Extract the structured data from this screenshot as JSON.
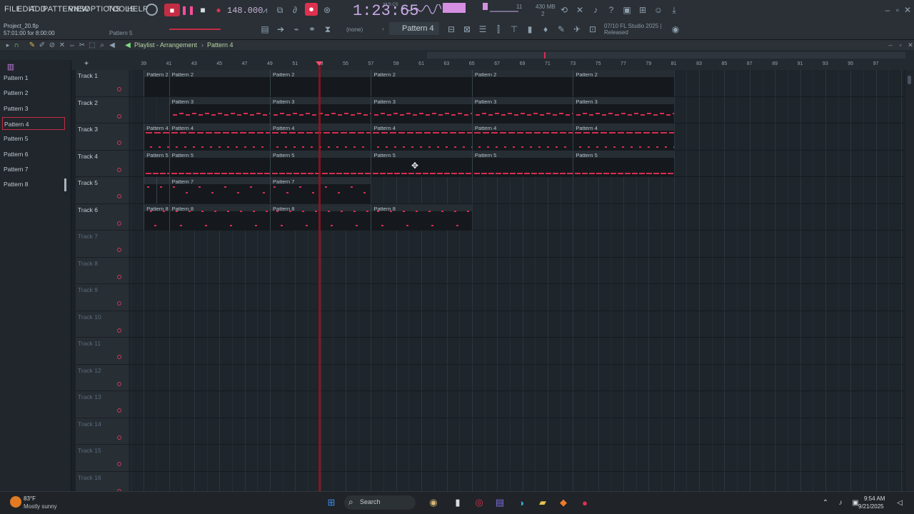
{
  "menu": [
    "FILE",
    "EDIT",
    "ADD",
    "PATTERNS",
    "VIEW",
    "OPTIONS",
    "TOOLS",
    "HELP"
  ],
  "project": {
    "name": "Project_20.flp",
    "time_info": "57:01:00 for 8:00:00",
    "hint": "Pattern 5"
  },
  "transport": {
    "tempo": "148.000",
    "time": "1:23:65",
    "time_label": "M:S:CS",
    "memory": "430 MB",
    "cpu_val": "11",
    "voices": "2"
  },
  "pattern_selector": {
    "current": "Pattern 4",
    "none_label": "(none)"
  },
  "news": {
    "line1": "07/10  FL Studio 2025 |",
    "line2": "Released"
  },
  "playlist": {
    "title": "Playlist - Arrangement",
    "separator": "›",
    "pattern": "Pattern 4"
  },
  "pattern_picker": [
    "Pattern 1",
    "Pattern 2",
    "Pattern 3",
    "Pattern 4",
    "Pattern 5",
    "Pattern 6",
    "Pattern 7",
    "Pattern 8"
  ],
  "ruler": [
    "39",
    "41",
    "43",
    "45",
    "47",
    "49",
    "51",
    "53",
    "55",
    "57",
    "59",
    "61",
    "63",
    "65",
    "67",
    "69",
    "71",
    "73",
    "75",
    "77",
    "79",
    "81",
    "83",
    "85",
    "87",
    "89",
    "91",
    "93",
    "95",
    "97"
  ],
  "tracks": [
    "Track 1",
    "Track 2",
    "Track 3",
    "Track 4",
    "Track 5",
    "Track 6",
    "Track 7",
    "Track 8",
    "Track 9",
    "Track 10",
    "Track 11",
    "Track 12",
    "Track 13",
    "Track 14",
    "Track 15",
    "Track 16"
  ],
  "clips": [
    {
      "track": 0,
      "label": "Pattern 2",
      "start": "39",
      "end": "41"
    },
    {
      "track": 0,
      "label": "Pattern 2",
      "start": "41",
      "end": "49"
    },
    {
      "track": 0,
      "label": "Pattern 2",
      "start": "49",
      "end": "57"
    },
    {
      "track": 0,
      "label": "Pattern 2",
      "start": "57",
      "end": "65"
    },
    {
      "track": 0,
      "label": "Pattern 2",
      "start": "65",
      "end": "73"
    },
    {
      "track": 0,
      "label": "Pattern 2",
      "start": "73",
      "end": "81"
    },
    {
      "track": 1,
      "label": "Pattern 3",
      "start": "41",
      "end": "49"
    },
    {
      "track": 1,
      "label": "Pattern 3",
      "start": "49",
      "end": "57"
    },
    {
      "track": 1,
      "label": "Pattern 3",
      "start": "57",
      "end": "65"
    },
    {
      "track": 1,
      "label": "Pattern 3",
      "start": "65",
      "end": "73"
    },
    {
      "track": 1,
      "label": "Pattern 3",
      "start": "73",
      "end": "81"
    },
    {
      "track": 2,
      "label": "Pattern 4",
      "start": "39",
      "end": "41"
    },
    {
      "track": 2,
      "label": "Pattern 4",
      "start": "41",
      "end": "49"
    },
    {
      "track": 2,
      "label": "Pattern 4",
      "start": "49",
      "end": "57"
    },
    {
      "track": 2,
      "label": "Pattern 4",
      "start": "57",
      "end": "65"
    },
    {
      "track": 2,
      "label": "Pattern 4",
      "start": "65",
      "end": "73"
    },
    {
      "track": 2,
      "label": "Pattern 4",
      "start": "73",
      "end": "81"
    },
    {
      "track": 3,
      "label": "Pattern 5",
      "start": "39",
      "end": "41"
    },
    {
      "track": 3,
      "label": "Pattern 5",
      "start": "41",
      "end": "49"
    },
    {
      "track": 3,
      "label": "Pattern 5",
      "start": "49",
      "end": "57"
    },
    {
      "track": 3,
      "label": "Pattern 5",
      "start": "57",
      "end": "65"
    },
    {
      "track": 3,
      "label": "Pattern 5",
      "start": "65",
      "end": "73"
    },
    {
      "track": 3,
      "label": "Pattern 5",
      "start": "73",
      "end": "81"
    },
    {
      "track": 4,
      "label": "",
      "start": "39",
      "end": "40"
    },
    {
      "track": 4,
      "label": "",
      "start": "40",
      "end": "41"
    },
    {
      "track": 4,
      "label": "Pattern 7",
      "start": "41",
      "end": "49"
    },
    {
      "track": 4,
      "label": "Pattern 7",
      "start": "49",
      "end": "57"
    },
    {
      "track": 5,
      "label": "Pattern 8",
      "start": "39",
      "end": "41"
    },
    {
      "track": 5,
      "label": "Pattern 8",
      "start": "41",
      "end": "49"
    },
    {
      "track": 5,
      "label": "Pattern 8",
      "start": "49",
      "end": "57"
    },
    {
      "track": 5,
      "label": "Pattern 8",
      "start": "57",
      "end": "65"
    }
  ],
  "taskbar": {
    "temp": "83°F",
    "weather": "Mostly sunny",
    "search": "Search",
    "time": "9:54 AM",
    "date": "9/21/2025"
  },
  "colors": {
    "accent": "#d62d52",
    "playhead": "#9a1323",
    "time": "#c7a8e6"
  }
}
